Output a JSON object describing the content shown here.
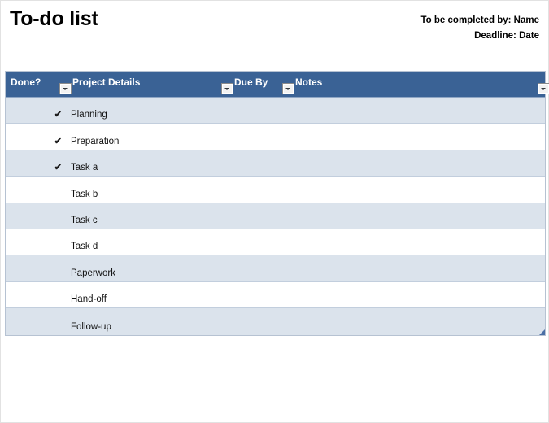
{
  "document": {
    "title": "To-do list",
    "meta": [
      "To be completed by: Name",
      "Deadline: Date"
    ]
  },
  "table": {
    "columns": [
      {
        "key": "done",
        "label": "Done?",
        "filter_icon": "chevron-down-icon"
      },
      {
        "key": "details",
        "label": "Project Details",
        "filter_icon": "chevron-down-icon"
      },
      {
        "key": "due",
        "label": "Due By",
        "filter_icon": "chevron-down-icon"
      },
      {
        "key": "notes",
        "label": "Notes",
        "filter_icon": "chevron-down-icon"
      }
    ],
    "check_glyph": "✔",
    "rows": [
      {
        "done": "✔",
        "details": "Planning",
        "due": "",
        "notes": ""
      },
      {
        "done": "✔",
        "details": "Preparation",
        "due": "",
        "notes": ""
      },
      {
        "done": "✔",
        "details": "Task a",
        "due": "",
        "notes": ""
      },
      {
        "done": "",
        "details": "Task b",
        "due": "",
        "notes": ""
      },
      {
        "done": "",
        "details": "Task c",
        "due": "",
        "notes": ""
      },
      {
        "done": "",
        "details": "Task d",
        "due": "",
        "notes": ""
      },
      {
        "done": "",
        "details": "Paperwork",
        "due": "",
        "notes": ""
      },
      {
        "done": "",
        "details": "Hand-off",
        "due": "",
        "notes": ""
      },
      {
        "done": "",
        "details": "Follow-up",
        "due": "",
        "notes": ""
      }
    ]
  },
  "colors": {
    "header_blue": "#3a6295",
    "band_blue": "#dbe3ec",
    "row_white": "#ffffff",
    "grid_line": "#c2cedd",
    "resize_handle": "#4a6fa5"
  }
}
